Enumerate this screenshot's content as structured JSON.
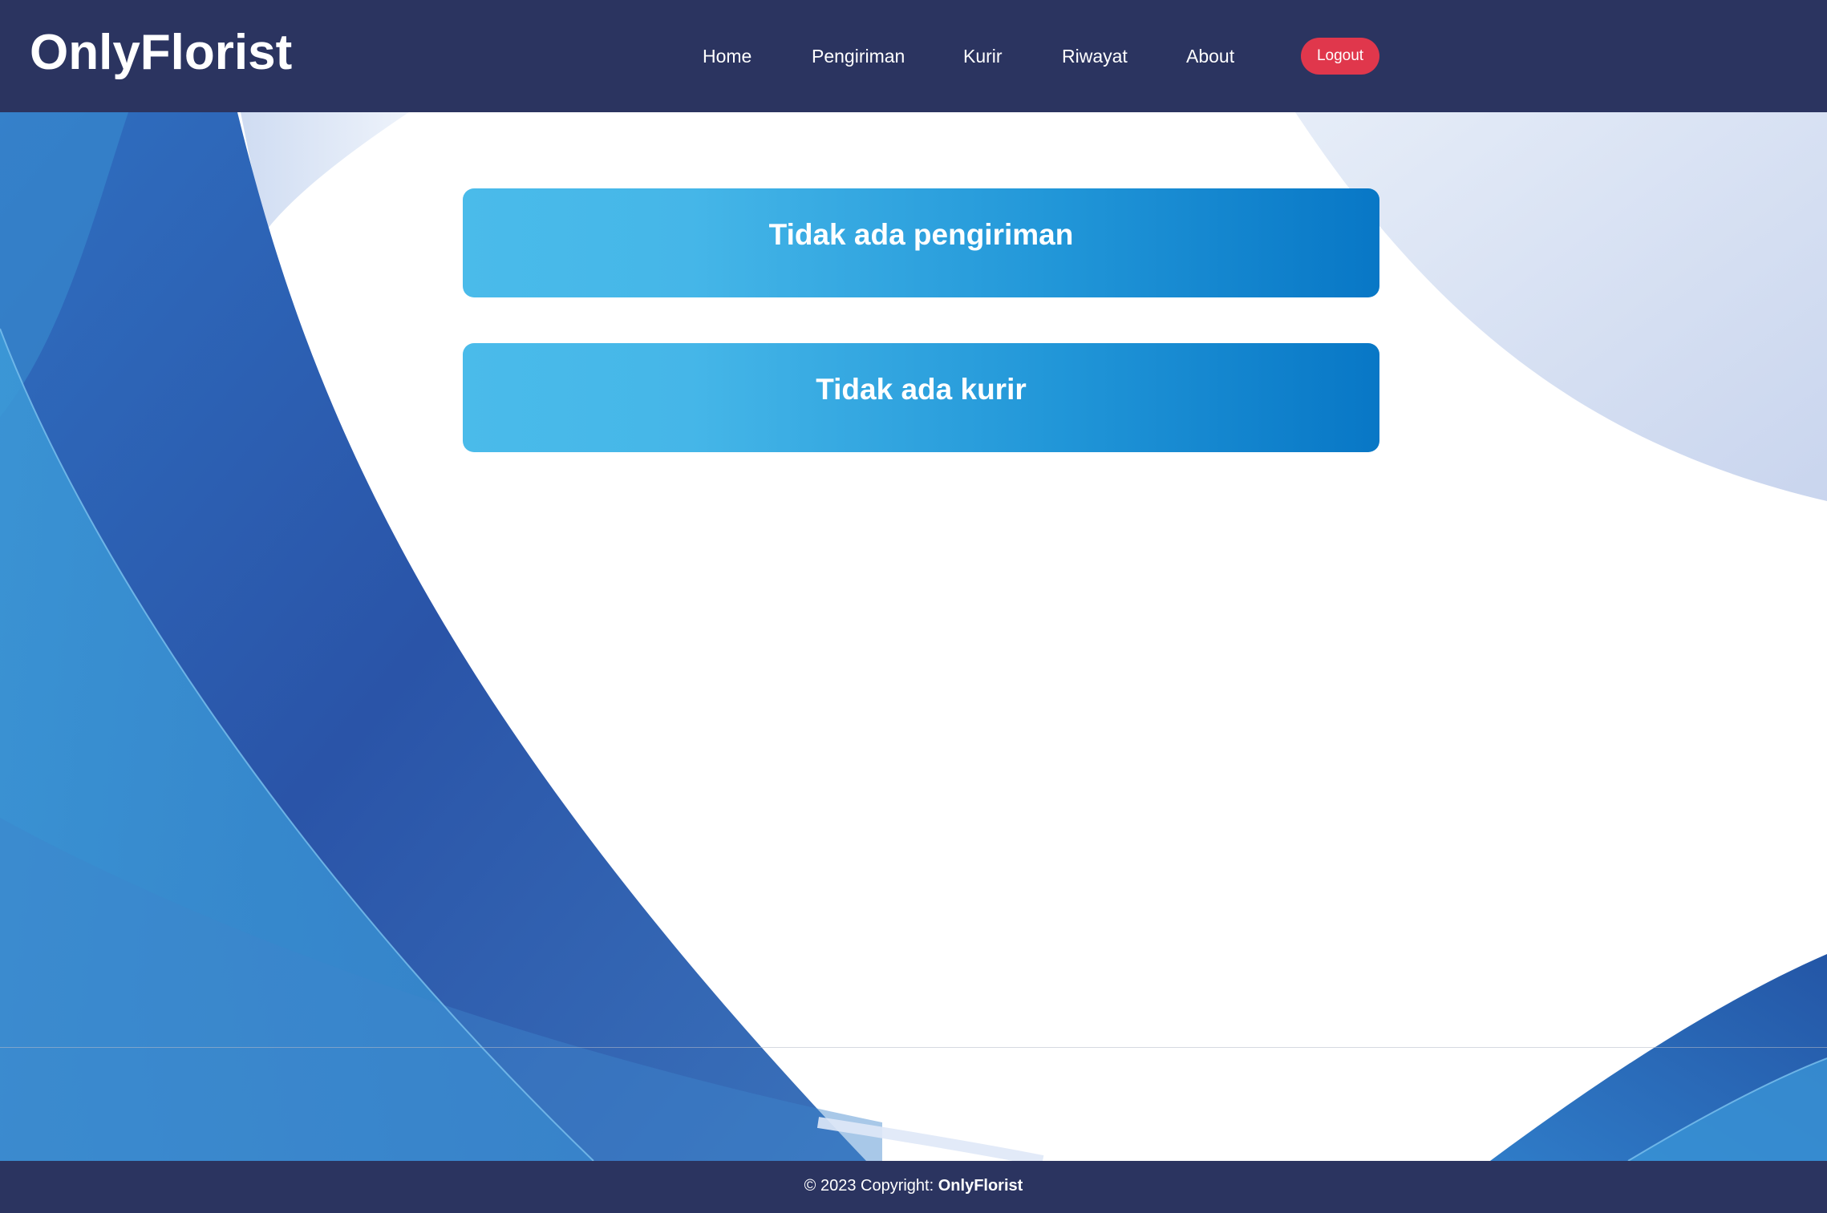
{
  "navbar": {
    "brand": "OnlyFlorist",
    "links": [
      "Home",
      "Pengiriman",
      "Kurir",
      "Riwayat",
      "About"
    ],
    "logout_label": "Logout"
  },
  "main": {
    "cards": [
      {
        "title": "Tidak ada pengiriman"
      },
      {
        "title": "Tidak ada kurir"
      }
    ]
  },
  "footer": {
    "copyright": "© 2023 Copyright:",
    "brand": "OnlyFlorist"
  },
  "colors": {
    "navbar_bg": "#2b3460",
    "logout_bg": "#e0374c",
    "card_gradient_start": "#4abbea",
    "card_gradient_end": "#0877c6",
    "background_wave_dark": "#2650a8",
    "background_wave_light": "#3a97d8"
  }
}
